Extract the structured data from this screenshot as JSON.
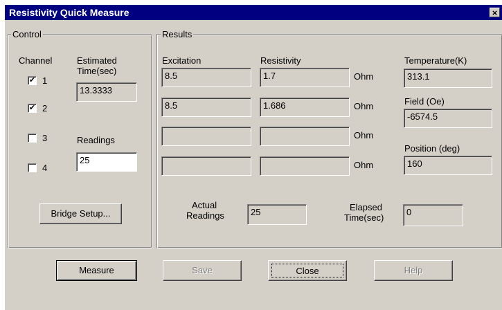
{
  "window": {
    "title": "Resistivity Quick Measure",
    "close_glyph": "×"
  },
  "control": {
    "legend": "Control",
    "channel_header": "Channel",
    "estimated_time_label_line1": "Estimated",
    "estimated_time_label_line2": "Time(sec)",
    "estimated_time_value": "13.3333",
    "readings_label": "Readings",
    "readings_value": "25",
    "channels": [
      {
        "label": "1",
        "checked": "✔"
      },
      {
        "label": "2",
        "checked": "✔"
      },
      {
        "label": "3",
        "checked": ""
      },
      {
        "label": "4",
        "checked": ""
      }
    ],
    "bridge_setup_label": "Bridge Setup..."
  },
  "results": {
    "legend": "Results",
    "excitation_header": "Excitation",
    "resistivity_header": "Resistivity",
    "unit": "Ohm",
    "rows": [
      {
        "excitation": "8.5",
        "resistivity": "1.7"
      },
      {
        "excitation": "8.5",
        "resistivity": "1.686"
      },
      {
        "excitation": "",
        "resistivity": ""
      },
      {
        "excitation": "",
        "resistivity": ""
      }
    ],
    "temperature_label": "Temperature(K)",
    "temperature_value": "313.1",
    "field_label": "Field (Oe)",
    "field_value": "-6574.5",
    "position_label": "Position (deg)",
    "position_value": "160",
    "actual_readings_line1": "Actual",
    "actual_readings_line2": "Readings",
    "actual_readings_value": "25",
    "elapsed_time_line1": "Elapsed",
    "elapsed_time_line2": "Time(sec)",
    "elapsed_time_value": "0"
  },
  "buttons": {
    "measure": "Measure",
    "save": "Save",
    "close": "Close",
    "help": "Help"
  },
  "colors": {
    "titlebar": "#000080",
    "face": "#d4d0c8",
    "disabled_text": "#808080"
  }
}
